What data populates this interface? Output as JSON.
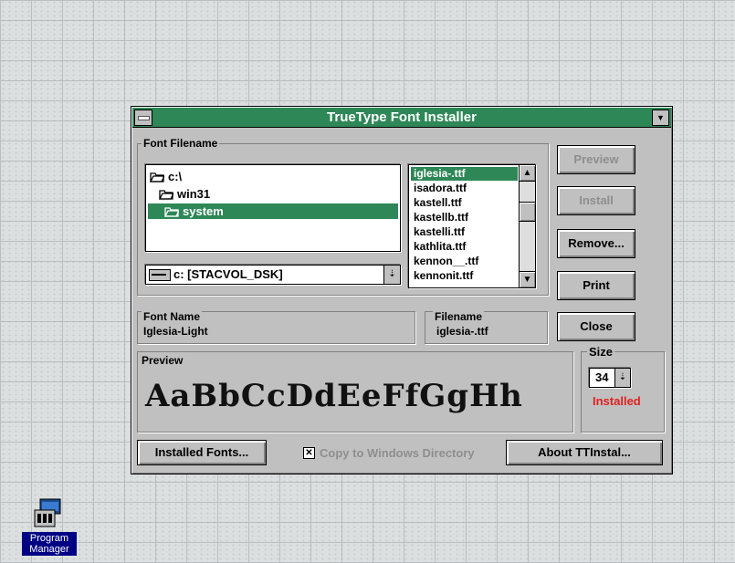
{
  "window": {
    "title": "TrueType Font Installer"
  },
  "font_filename": {
    "label": "Font Filename",
    "tree": [
      {
        "label": "c:\\",
        "selected": false
      },
      {
        "label": "win31",
        "selected": false
      },
      {
        "label": "system",
        "selected": true
      }
    ],
    "drive": "c: [STACVOL_DSK]",
    "files": [
      {
        "name": "iglesia-.ttf",
        "selected": true
      },
      {
        "name": "isadora.ttf",
        "selected": false
      },
      {
        "name": "kastell.ttf",
        "selected": false
      },
      {
        "name": "kastellb.ttf",
        "selected": false
      },
      {
        "name": "kastelli.ttf",
        "selected": false
      },
      {
        "name": "kathlita.ttf",
        "selected": false
      },
      {
        "name": "kennon__.ttf",
        "selected": false
      },
      {
        "name": "kennonit.ttf",
        "selected": false
      }
    ]
  },
  "buttons": {
    "preview": "Preview",
    "install": "Install",
    "remove": "Remove...",
    "print": "Print",
    "close": "Close",
    "installed_fonts": "Installed Fonts...",
    "about": "About TTInstal..."
  },
  "font_name": {
    "label": "Font Name",
    "value": "Iglesia-Light"
  },
  "filename": {
    "label": "Filename",
    "value": "iglesia-.ttf"
  },
  "preview": {
    "label": "Preview",
    "sample": "AaBbCcDdEeFfGgHh"
  },
  "size": {
    "label": "Size",
    "value": "34",
    "status": "Installed",
    "status_color": "#e02020"
  },
  "copy_option": {
    "label": "Copy to Windows Directory",
    "checked": true
  },
  "desktop": {
    "program_manager_label": "Program Manager"
  },
  "colors": {
    "title_bar": "#2e8757",
    "selection": "#2e8757"
  }
}
